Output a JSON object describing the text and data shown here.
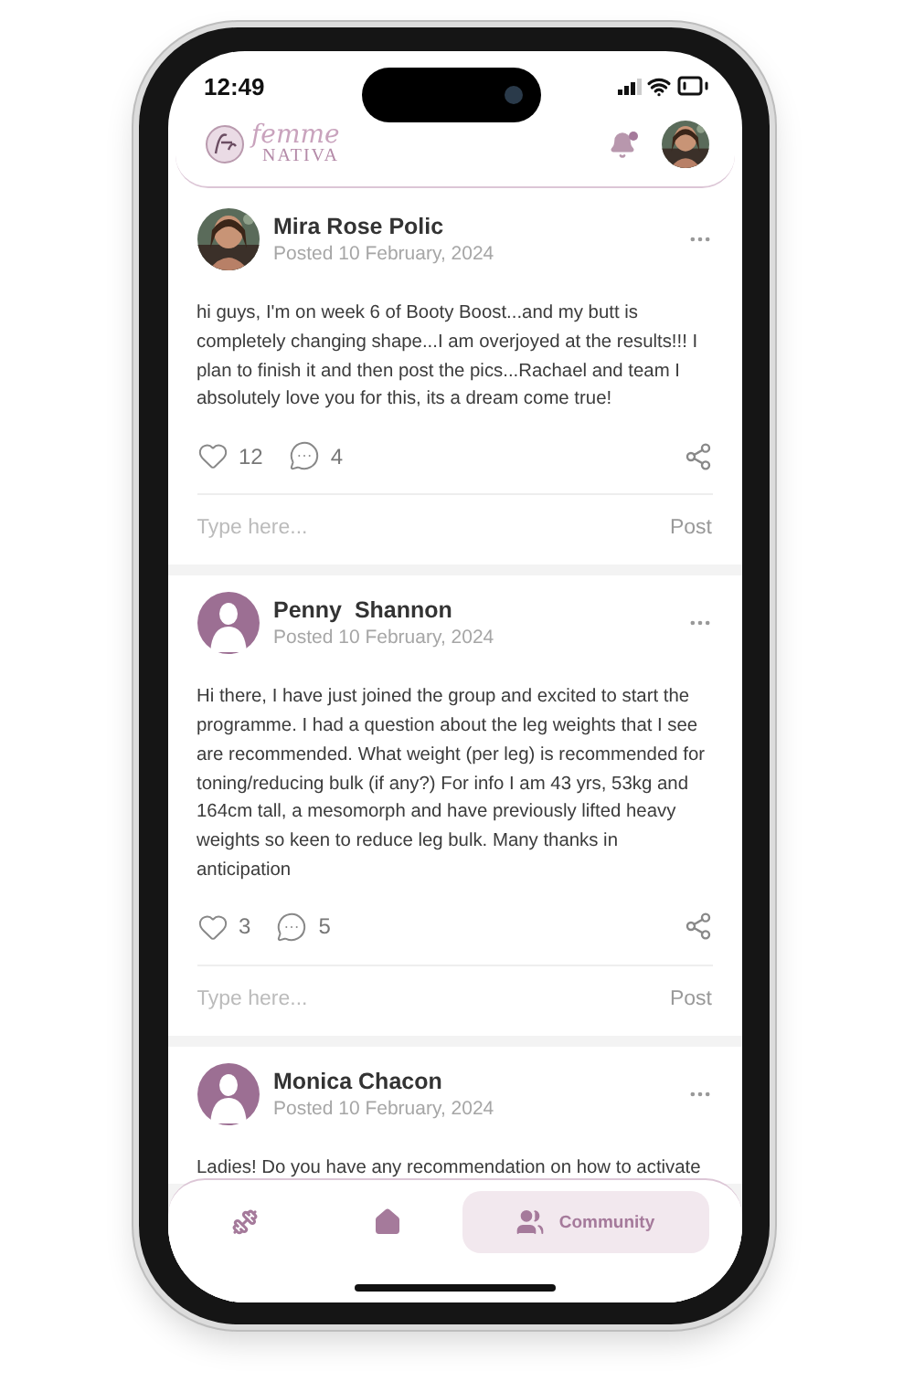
{
  "status_bar": {
    "time": "12:49"
  },
  "header": {
    "logo_word": "femme",
    "logo_subword": "NATIVA",
    "unread": true
  },
  "posts": [
    {
      "author": "Mira Rose Polic",
      "date": "Posted 10 February, 2024",
      "body": "hi guys, I'm on week 6 of Booty Boost...and my butt is completely changing shape...I am overjoyed at the results!!! I plan to finish it and then post the pics...Rachael and team I absolutely love you for this, its a dream come true!",
      "likes": "12",
      "comments": "4",
      "reply": {
        "placeholder": "Type here...",
        "button": "Post"
      }
    },
    {
      "author": "Penny  Shannon",
      "date": "Posted 10 February, 2024",
      "avatar": {
        "kind": "silhouette"
      },
      "body": "Hi there, I have just joined the group and excited to start the programme. I had a question about the leg weights that I see are recommended. What weight (per leg) is recommended for toning/reducing bulk (if any?) For info I am 43 yrs, 53kg and 164cm tall, a mesomorph and have previously lifted heavy weights so keen to reduce leg bulk. Many thanks in anticipation",
      "likes": "3",
      "comments": "5",
      "reply": {
        "placeholder": "Type here...",
        "button": "Post"
      }
    },
    {
      "author": "Monica Chacon",
      "date": "Posted 10 February, 2024",
      "avatar": {
        "kind": "silhouette"
      },
      "body": "Ladies! Do you have any recommendation on how to activate"
    }
  ],
  "nav": [
    {
      "kind": "dumbbell",
      "selected": false
    },
    {
      "kind": "home",
      "selected": false
    },
    {
      "kind": "community",
      "label": "Community",
      "selected": true
    }
  ]
}
